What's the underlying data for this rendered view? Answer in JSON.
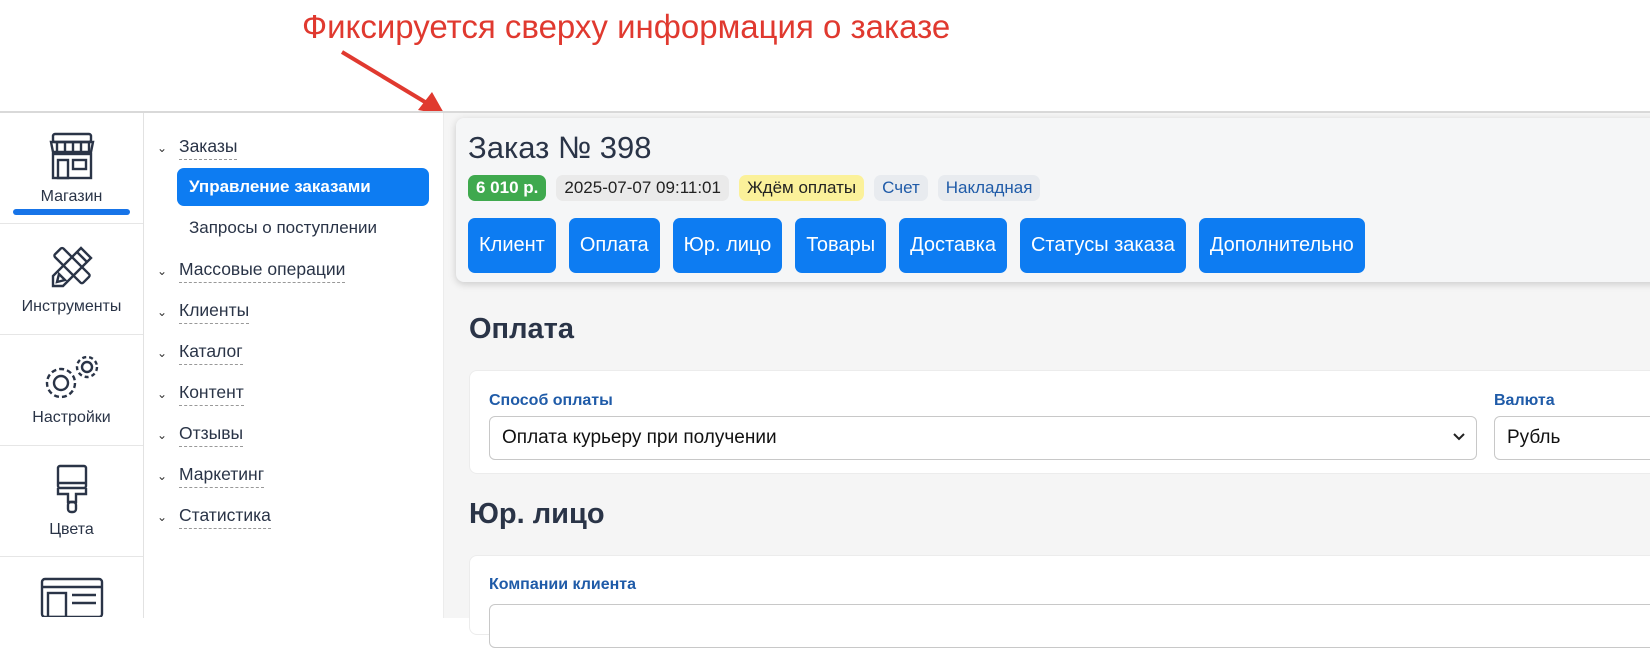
{
  "annotation": {
    "text": "Фиксируется сверху информация о заказе",
    "color": "#e0392f"
  },
  "rail": [
    {
      "label": "Магазин",
      "icon": "store-icon",
      "active": true
    },
    {
      "label": "Инструменты",
      "icon": "tools-icon",
      "active": false
    },
    {
      "label": "Настройки",
      "icon": "gears-icon",
      "active": false
    },
    {
      "label": "Цвета",
      "icon": "brush-icon",
      "active": false
    }
  ],
  "menu": {
    "orders": {
      "label": "Заказы",
      "sub": [
        "Управление заказами",
        "Запросы о поступлении"
      ]
    },
    "groups": [
      "Массовые операции",
      "Клиенты",
      "Каталог",
      "Контент",
      "Отзывы",
      "Маркетинг",
      "Статистика"
    ]
  },
  "order": {
    "title": "Заказ № 398",
    "sum": "6 010 р.",
    "date": "2025-07-07 09:11:01",
    "status": "Ждём оплаты",
    "links": [
      "Счет",
      "Накладная"
    ],
    "tabs": [
      "Клиент",
      "Оплата",
      "Юр. лицо",
      "Товары",
      "Доставка",
      "Статусы заказа",
      "Дополнительно"
    ]
  },
  "payment": {
    "title": "Оплата",
    "method_label": "Способ оплаты",
    "method_value": "Оплата курьеру при получении",
    "currency_label": "Валюта",
    "currency_value": "Рубль"
  },
  "legal": {
    "title": "Юр. лицо",
    "companies_label": "Компании клиента"
  },
  "colors": {
    "accent": "#0d7cf2",
    "sum": "#3fa94e",
    "status": "#fbf19a",
    "label": "#1f5ba8"
  }
}
